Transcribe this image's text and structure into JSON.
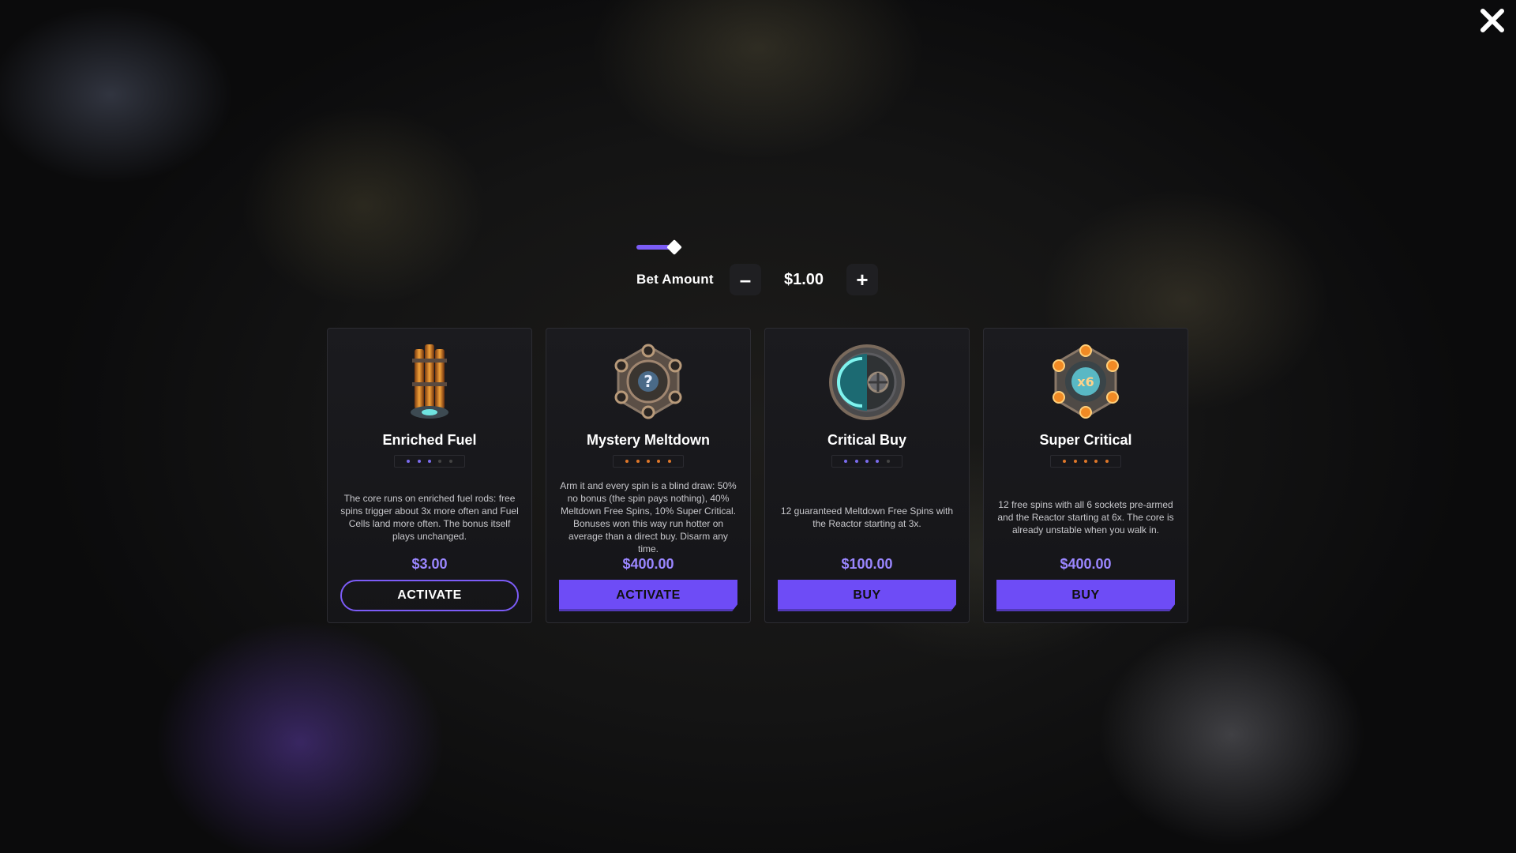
{
  "close_icon": "close-icon",
  "bet": {
    "label": "Bet Amount",
    "decrement": "–",
    "increment": "+",
    "value": "$1.00"
  },
  "colors": {
    "accent": "#7c5cf7",
    "price": "#9a86ff",
    "dot_purple": "#7c6cf0",
    "dot_orange": "#e0782a"
  },
  "cards": [
    {
      "title": "Enriched Fuel",
      "icon": "fuel-rod-icon",
      "description": "The core runs on enriched fuel rods: free spins trigger about 3x more often and Fuel Cells land more often. The bonus itself plays unchanged.",
      "price": "$3.00",
      "action": "ACTIVATE",
      "volatility_dots": 3,
      "dot_color": "purple"
    },
    {
      "title": "Mystery Meltdown",
      "icon": "mystery-core-icon",
      "description": "Arm it and every spin is a blind draw: 50% no bonus (the spin pays nothing), 40% Meltdown Free Spins, 10% Super Critical. Bonuses won this way run hotter on average than a direct buy. Disarm any time.",
      "price": "$400.00",
      "action": "ACTIVATE",
      "volatility_dots": 5,
      "dot_color": "orange"
    },
    {
      "title": "Critical Buy",
      "icon": "reactor-core-icon",
      "description": "12 guaranteed Meltdown Free Spins with the Reactor starting at 3x.",
      "price": "$100.00",
      "action": "BUY",
      "volatility_dots": 4,
      "dot_color": "purple"
    },
    {
      "title": "Super Critical",
      "icon": "x6-core-icon",
      "description": "12 free spins with all 6 sockets pre-armed and the Reactor starting at 6x. The core is already unstable when you walk in.",
      "price": "$400.00",
      "action": "BUY",
      "volatility_dots": 5,
      "dot_color": "orange"
    }
  ],
  "x6_badge": "x6",
  "mystery_badge": "?"
}
